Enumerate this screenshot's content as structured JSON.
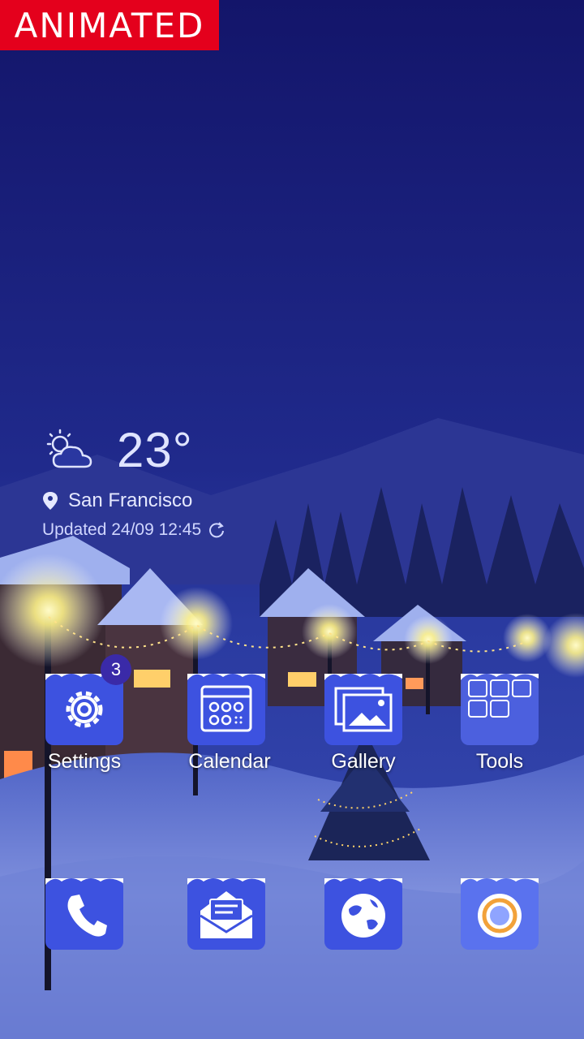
{
  "promo_badge": "ANIMATED",
  "weather": {
    "icon": "partly-cloudy-icon",
    "temperature": "23°",
    "location": "San Francisco",
    "updated": "Updated 24/09 12:45"
  },
  "apps_row1": [
    {
      "label": "Settings",
      "icon": "gear-icon",
      "badge": "3"
    },
    {
      "label": "Calendar",
      "icon": "calendar-icon"
    },
    {
      "label": "Gallery",
      "icon": "gallery-icon"
    },
    {
      "label": "Tools",
      "icon": "tools-folder-icon"
    }
  ],
  "dock": [
    {
      "icon": "phone-icon"
    },
    {
      "icon": "messages-icon"
    },
    {
      "icon": "browser-globe-icon"
    },
    {
      "icon": "camera-icon"
    }
  ],
  "colors": {
    "tile": "#3d52e0",
    "badge_red": "#e4001c",
    "sky_top": "#13156a"
  }
}
